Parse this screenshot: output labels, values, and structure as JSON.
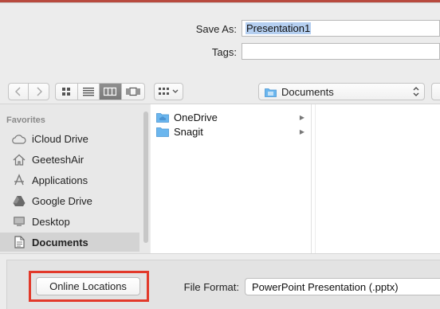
{
  "save_as": {
    "label": "Save As:",
    "value": "Presentation1"
  },
  "tags": {
    "label": "Tags:",
    "value": ""
  },
  "toolbar": {
    "location_popup": "Documents"
  },
  "sidebar": {
    "heading": "Favorites",
    "items": [
      {
        "label": "iCloud Drive",
        "icon": "cloud-icon"
      },
      {
        "label": "GeeteshAir",
        "icon": "home-icon"
      },
      {
        "label": "Applications",
        "icon": "applications-icon"
      },
      {
        "label": "Google Drive",
        "icon": "google-drive-icon"
      },
      {
        "label": "Desktop",
        "icon": "desktop-icon"
      },
      {
        "label": "Documents",
        "icon": "documents-icon",
        "selected": true
      }
    ]
  },
  "files": [
    {
      "name": "OneDrive",
      "icon": "folder-icon"
    },
    {
      "name": "Snagit",
      "icon": "folder-icon"
    }
  ],
  "bottom": {
    "online_locations": "Online Locations",
    "file_format_label": "File Format:",
    "file_format_value": "PowerPoint Presentation (.pptx)"
  },
  "colors": {
    "highlight": "#e2392a",
    "folder": "#6bb6ee",
    "selection": "#b5cff0"
  }
}
